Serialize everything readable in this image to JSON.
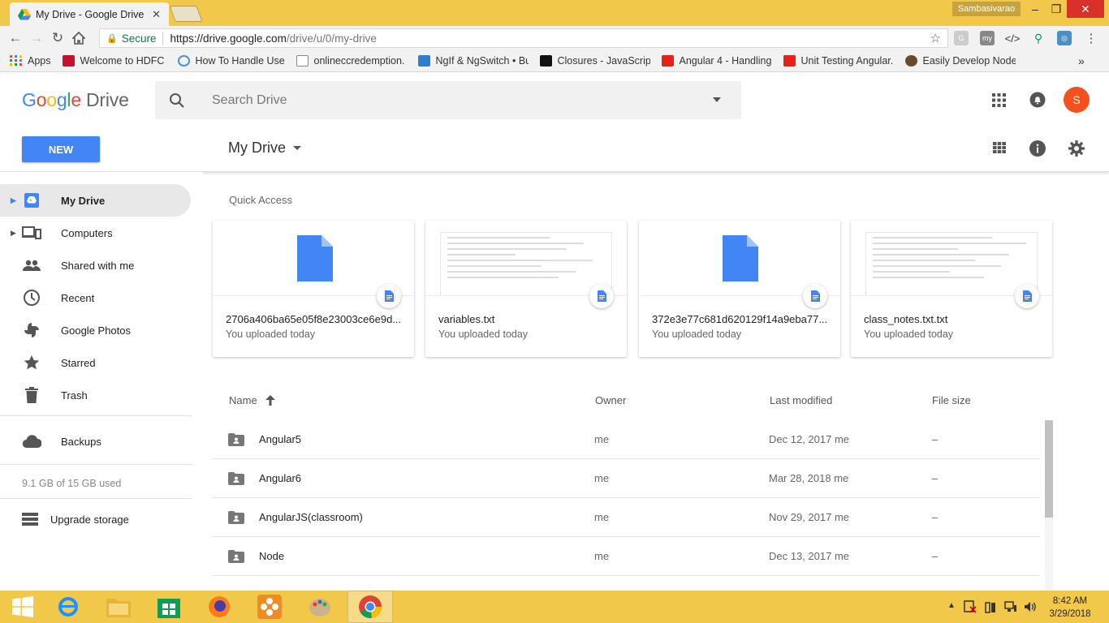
{
  "browser": {
    "tab_title": "My Drive - Google Drive",
    "tab_close": "✕",
    "user_name": "Sambasivarao",
    "win_minimize": "–",
    "win_restore": "❐",
    "win_close": "✕",
    "secure_label": "Secure",
    "url_host": "https://drive.google.com",
    "url_path": "/drive/u/0/my-drive",
    "bookmarks": [
      {
        "label": "Apps",
        "icon": "apps-grid-icon"
      },
      {
        "label": "Welcome to HDFC Ba",
        "icon": "hdfc-icon"
      },
      {
        "label": "How To Handle User",
        "icon": "globe-icon"
      },
      {
        "label": "onlineccredemption.",
        "icon": "page-icon"
      },
      {
        "label": "NgIf & NgSwitch • Bu",
        "icon": "robot-icon"
      },
      {
        "label": "Closures - JavaScript",
        "icon": "mdn-icon"
      },
      {
        "label": "Angular 4 - Handling",
        "icon": "youtube-icon"
      },
      {
        "label": "Unit Testing Angular.",
        "icon": "youtube-icon"
      },
      {
        "label": "Easily Develop Node.",
        "icon": "node-icon"
      }
    ],
    "bookmarks_more": "»"
  },
  "drive": {
    "logo_google": "Google",
    "logo_drive": "Drive",
    "search_placeholder": "Search Drive",
    "user_initial": "S",
    "new_button": "NEW",
    "location_title": "My Drive",
    "sidebar": [
      {
        "label": "My Drive",
        "icon": "drive-icon",
        "active": true
      },
      {
        "label": "Computers",
        "icon": "computers-icon"
      },
      {
        "label": "Shared with me",
        "icon": "people-icon"
      },
      {
        "label": "Recent",
        "icon": "clock-icon"
      },
      {
        "label": "Google Photos",
        "icon": "pinwheel-icon"
      },
      {
        "label": "Starred",
        "icon": "star-icon"
      },
      {
        "label": "Trash",
        "icon": "trash-icon"
      },
      {
        "label": "Backups",
        "icon": "cloud-icon"
      }
    ],
    "storage_used": "9.1 GB of 15 GB used",
    "upgrade_storage": "Upgrade storage",
    "quick_access_title": "Quick Access",
    "quick_access": [
      {
        "name": "2706a406ba65e05f8e23003ce6e9d...",
        "sub": "You uploaded today",
        "thumb": "doc"
      },
      {
        "name": "variables.txt",
        "sub": "You uploaded today",
        "thumb": "text"
      },
      {
        "name": "372e3e77c681d620129f14a9eba77...",
        "sub": "You uploaded today",
        "thumb": "doc"
      },
      {
        "name": "class_notes.txt.txt",
        "sub": "You uploaded today",
        "thumb": "text"
      }
    ],
    "columns": {
      "name": "Name",
      "owner": "Owner",
      "modified": "Last modified",
      "size": "File size"
    },
    "files": [
      {
        "name": "Angular5",
        "owner": "me",
        "modified": "Dec 12, 2017 me",
        "size": "–"
      },
      {
        "name": "Angular6",
        "owner": "me",
        "modified": "Mar 28, 2018 me",
        "size": "–"
      },
      {
        "name": "AngularJS(classroom)",
        "owner": "me",
        "modified": "Nov 29, 2017 me",
        "size": "–"
      },
      {
        "name": "Node",
        "owner": "me",
        "modified": "Dec 13, 2017 me",
        "size": "–"
      }
    ]
  },
  "taskbar": {
    "time": "8:42 AM",
    "date": "3/29/2018"
  },
  "colors": {
    "accent": "#4285f4",
    "window_frame": "#f2c84b",
    "avatar": "#f4511e"
  }
}
